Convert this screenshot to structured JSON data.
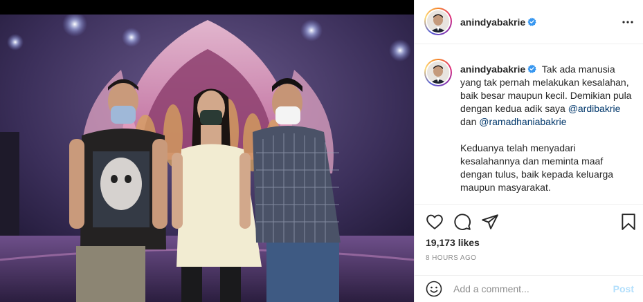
{
  "account": {
    "username": "anindyabakrie",
    "verified": true
  },
  "caption": {
    "text1": "Tak ada manusia yang tak pernah melakukan kesalahan, baik besar maupun kecil. Demikian pula dengan kedua adik saya",
    "mention1": "@ardibakrie",
    "connector": "dan",
    "mention2": "@ramadhaniabakrie",
    "text2": "Keduanya telah menyadari kesalahannya dan meminta maaf dengan tulus, baik kepada keluarga maupun masyarakat."
  },
  "stats": {
    "likes": "19,173 likes",
    "time": "8 HOURS AGO"
  },
  "comment": {
    "placeholder": "Add a comment...",
    "post_label": "Post"
  },
  "icons": {
    "verified": "verified-badge-icon",
    "more": "more-options-icon",
    "like": "heart-icon",
    "comment": "comment-icon",
    "share": "share-icon",
    "save": "bookmark-icon",
    "emoji": "emoji-icon"
  },
  "colors": {
    "verified_blue": "#3897f0",
    "mention": "#00376b",
    "muted": "#8e8e8e",
    "post_button_disabled": "#b2dffc"
  }
}
